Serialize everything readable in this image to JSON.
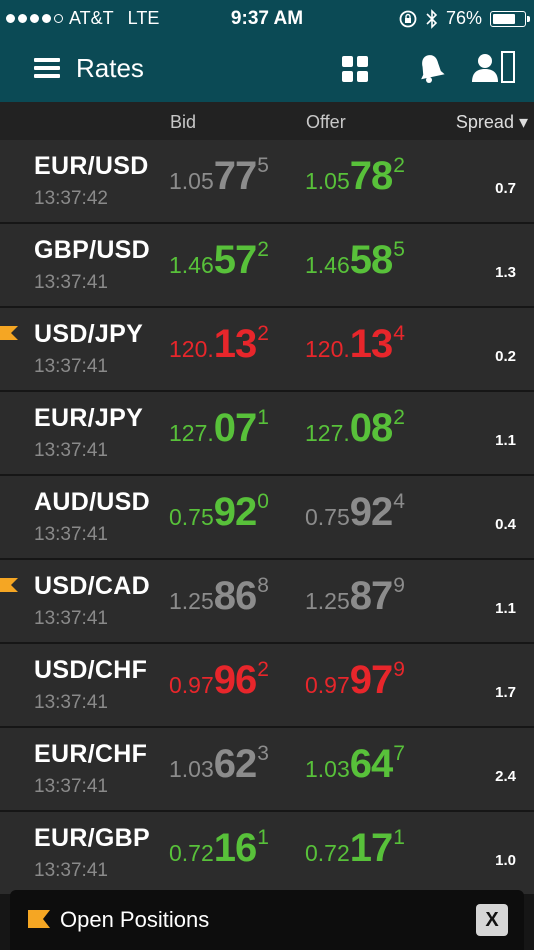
{
  "status_bar": {
    "carrier": "AT&T",
    "network": "LTE",
    "time": "9:37 AM",
    "battery": "76%",
    "battery_level": 0.76,
    "signal_bars": 4
  },
  "nav": {
    "title": "Rates",
    "icons": [
      "menu-icon",
      "grid-icon",
      "bell-icon",
      "user-icon"
    ]
  },
  "columns": {
    "bid": "Bid",
    "offer": "Offer",
    "spread": "Spread ▾"
  },
  "colors": {
    "header_bg": "#0b4a55",
    "up": "#58c13a",
    "down": "#e8262b",
    "neutral": "#8c8c8c",
    "flag": "#f5a623"
  },
  "rates": [
    {
      "pair": "EUR/USD",
      "time": "13:37:42",
      "flag": false,
      "spread": "0.7",
      "bid": {
        "pre": "1.05",
        "big": "77",
        "sup": "5",
        "color": "grey"
      },
      "offer": {
        "pre": "1.05",
        "big": "78",
        "sup": "2",
        "color": "green"
      }
    },
    {
      "pair": "GBP/USD",
      "time": "13:37:41",
      "flag": false,
      "spread": "1.3",
      "bid": {
        "pre": "1.46",
        "big": "57",
        "sup": "2",
        "color": "green"
      },
      "offer": {
        "pre": "1.46",
        "big": "58",
        "sup": "5",
        "color": "green"
      }
    },
    {
      "pair": "USD/JPY",
      "time": "13:37:41",
      "flag": true,
      "spread": "0.2",
      "bid": {
        "pre": "120.",
        "big": "13",
        "sup": "2",
        "color": "red"
      },
      "offer": {
        "pre": "120.",
        "big": "13",
        "sup": "4",
        "color": "red"
      }
    },
    {
      "pair": "EUR/JPY",
      "time": "13:37:41",
      "flag": false,
      "spread": "1.1",
      "bid": {
        "pre": "127.",
        "big": "07",
        "sup": "1",
        "color": "green"
      },
      "offer": {
        "pre": "127.",
        "big": "08",
        "sup": "2",
        "color": "green"
      }
    },
    {
      "pair": "AUD/USD",
      "time": "13:37:41",
      "flag": false,
      "spread": "0.4",
      "bid": {
        "pre": "0.75",
        "big": "92",
        "sup": "0",
        "color": "green"
      },
      "offer": {
        "pre": "0.75",
        "big": "92",
        "sup": "4",
        "color": "grey"
      }
    },
    {
      "pair": "USD/CAD",
      "time": "13:37:41",
      "flag": true,
      "spread": "1.1",
      "bid": {
        "pre": "1.25",
        "big": "86",
        "sup": "8",
        "color": "grey"
      },
      "offer": {
        "pre": "1.25",
        "big": "87",
        "sup": "9",
        "color": "grey"
      }
    },
    {
      "pair": "USD/CHF",
      "time": "13:37:41",
      "flag": false,
      "spread": "1.7",
      "bid": {
        "pre": "0.97",
        "big": "96",
        "sup": "2",
        "color": "red"
      },
      "offer": {
        "pre": "0.97",
        "big": "97",
        "sup": "9",
        "color": "red"
      }
    },
    {
      "pair": "EUR/CHF",
      "time": "13:37:41",
      "flag": false,
      "spread": "2.4",
      "bid": {
        "pre": "1.03",
        "big": "62",
        "sup": "3",
        "color": "grey"
      },
      "offer": {
        "pre": "1.03",
        "big": "64",
        "sup": "7",
        "color": "green"
      }
    },
    {
      "pair": "EUR/GBP",
      "time": "13:37:41",
      "flag": false,
      "spread": "1.0",
      "bid": {
        "pre": "0.72",
        "big": "16",
        "sup": "1",
        "color": "green"
      },
      "offer": {
        "pre": "0.72",
        "big": "17",
        "sup": "1",
        "color": "green"
      }
    }
  ],
  "footer": {
    "label": "Open Positions",
    "close": "X"
  }
}
